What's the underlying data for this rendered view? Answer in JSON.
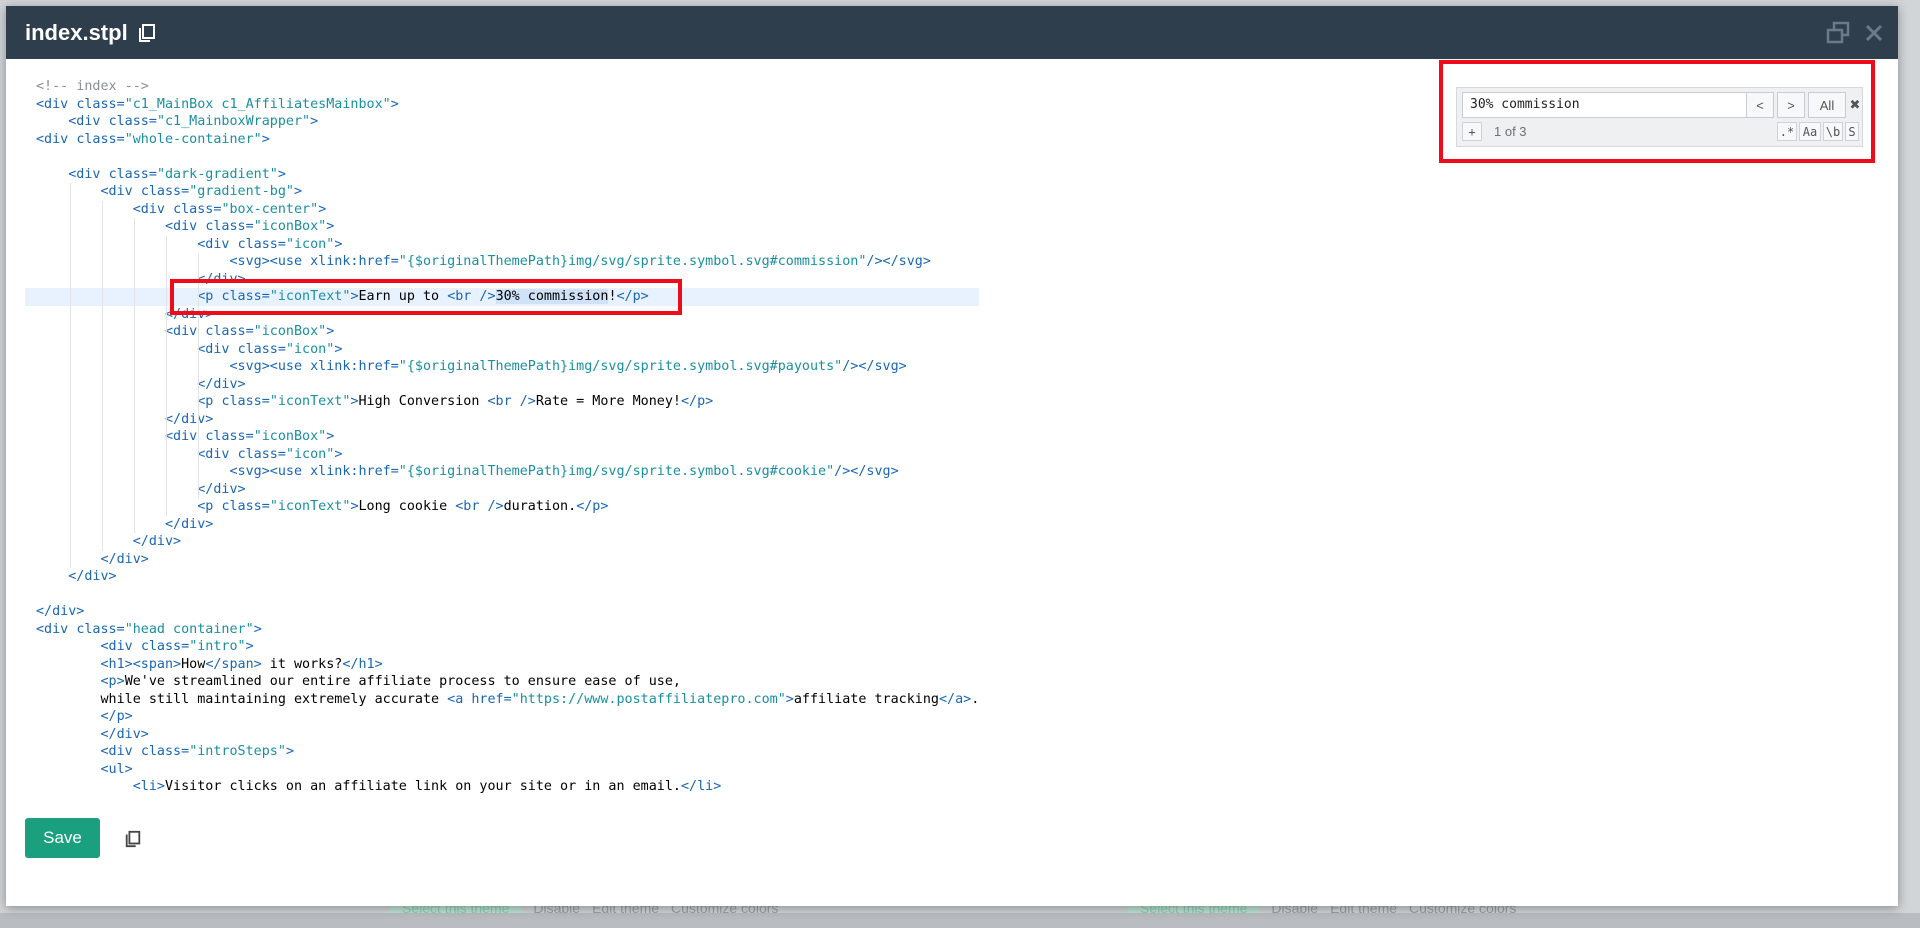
{
  "window": {
    "title": "index.stpl"
  },
  "search": {
    "value": "30% commission",
    "prev_label": "<",
    "next_label": ">",
    "all_label": "All",
    "close_label": "✖",
    "replace_toggle_label": "+",
    "result_count": "1 of 3",
    "regex_label": ".*",
    "case_label": "Aa",
    "word_label": "\\b",
    "selection_label": "S"
  },
  "footer": {
    "save_label": "Save"
  },
  "background": {
    "theme_actions_left": [
      "Select this theme",
      "Disable",
      "Edit theme",
      "Customize colors"
    ],
    "theme_actions_right": [
      "Select this theme",
      "Disable",
      "Edit theme",
      "Customize colors"
    ]
  },
  "code": {
    "lines": [
      "<!-- index -->",
      "<div class=\"c1_MainBox c1_AffiliatesMainbox\">",
      "    <div class=\"c1_MainboxWrapper\">",
      "<div class=\"whole-container\">",
      "",
      "    <div class=\"dark-gradient\">",
      "        <div class=\"gradient-bg\">",
      "            <div class=\"box-center\">",
      "                <div class=\"iconBox\">",
      "                    <div class=\"icon\">",
      "                        <svg><use xlink:href=\"{$originalThemePath}img/svg/sprite.symbol.svg#commission\"/></svg>",
      "                    </div>",
      "                    <p class=\"iconText\">Earn up to <br />30% commission!</p>",
      "                </div>",
      "                <div class=\"iconBox\">",
      "                    <div class=\"icon\">",
      "                        <svg><use xlink:href=\"{$originalThemePath}img/svg/sprite.symbol.svg#payouts\"/></svg>",
      "                    </div>",
      "                    <p class=\"iconText\">High Conversion <br />Rate = More Money!</p>",
      "                </div>",
      "                <div class=\"iconBox\">",
      "                    <div class=\"icon\">",
      "                        <svg><use xlink:href=\"{$originalThemePath}img/svg/sprite.symbol.svg#cookie\"/></svg>",
      "                    </div>",
      "                    <p class=\"iconText\">Long cookie <br />duration.</p>",
      "                </div>",
      "            </div>",
      "        </div>",
      "    </div>",
      "",
      "</div>",
      "<div class=\"head container\">",
      "        <div class=\"intro\">",
      "        <h1><span>How</span> it works?</h1>",
      "        <p>We've streamlined our entire affiliate process to ensure ease of use,",
      "        while still maintaining extremely accurate <a href=\"https://www.postaffiliatepro.com\">affiliate tracking</a>.",
      "        </p>",
      "        </div>",
      "        <div class=\"introSteps\">",
      "        <ul>",
      "            <li>Visitor clicks on an affiliate link on your site or in an email.</li>"
    ]
  }
}
